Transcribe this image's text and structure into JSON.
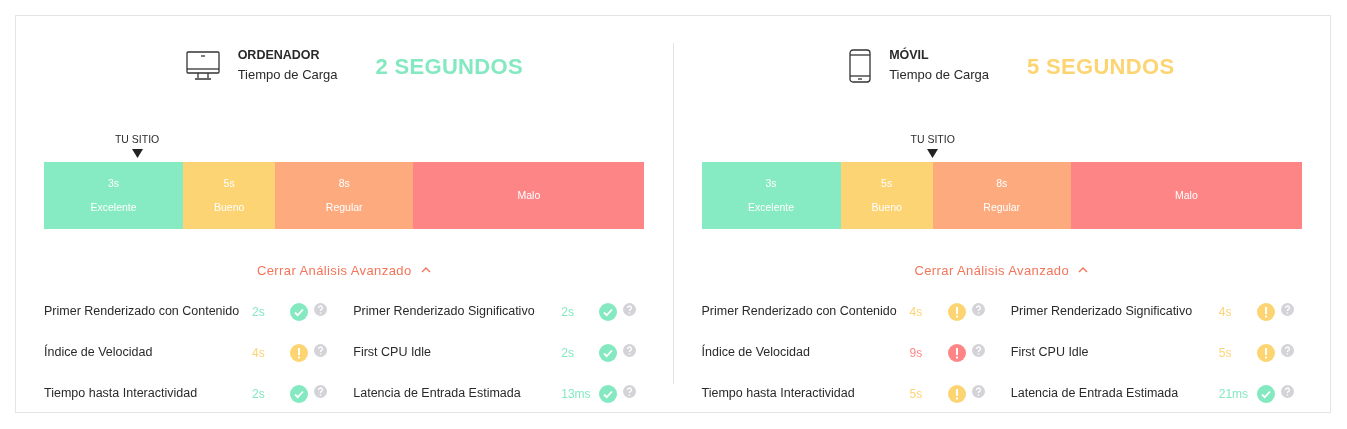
{
  "panels": [
    {
      "kind": "desktop",
      "title": "ORDENADOR",
      "subtitle": "Tiempo de Carga",
      "result": "2 SEGUNDOS",
      "color": "#84e9c0",
      "marker_label": "TU SITIO",
      "segments": [
        {
          "value": "3s",
          "label": "Excelente"
        },
        {
          "value": "5s",
          "label": "Bueno"
        },
        {
          "value": "8s",
          "label": "Regular"
        },
        {
          "label": "Malo"
        }
      ],
      "toggle": "Cerrar Análisis Avanzado",
      "expanded": true,
      "metrics": [
        {
          "label": "Primer Renderizado con Contenido",
          "value": "2s",
          "kind": "good"
        },
        {
          "label": "Primer Renderizado Significativo",
          "value": "2s",
          "kind": "good"
        },
        {
          "label": "Índice de Velocidad",
          "value": "4s",
          "kind": "warn"
        },
        {
          "label": "First CPU Idle",
          "value": "2s",
          "kind": "good"
        },
        {
          "label": "Tiempo hasta Interactividad",
          "value": "2s",
          "kind": "good"
        },
        {
          "label": "Latencia de Entrada Estimada",
          "value": "13ms",
          "kind": "good"
        }
      ]
    },
    {
      "kind": "mobile",
      "title": "MÓVIL",
      "subtitle": "Tiempo de Carga",
      "result": "5 SEGUNDOS",
      "color": "#fdd472",
      "marker_label": "TU SITIO",
      "segments": [
        {
          "value": "3s",
          "label": "Excelente"
        },
        {
          "value": "5s",
          "label": "Bueno"
        },
        {
          "value": "8s",
          "label": "Regular"
        },
        {
          "label": "Malo"
        }
      ],
      "toggle": "Cerrar Análisis Avanzado",
      "expanded": true,
      "metrics": [
        {
          "label": "Primer Renderizado con Contenido",
          "value": "4s",
          "kind": "warn"
        },
        {
          "label": "Primer Renderizado Significativo",
          "value": "4s",
          "kind": "warn"
        },
        {
          "label": "Índice de Velocidad",
          "value": "9s",
          "kind": "bad"
        },
        {
          "label": "First CPU Idle",
          "value": "5s",
          "kind": "warn"
        },
        {
          "label": "Tiempo hasta Interactividad",
          "value": "5s",
          "kind": "warn"
        },
        {
          "label": "Latencia de Entrada Estimada",
          "value": "21ms",
          "kind": "good"
        }
      ]
    }
  ]
}
